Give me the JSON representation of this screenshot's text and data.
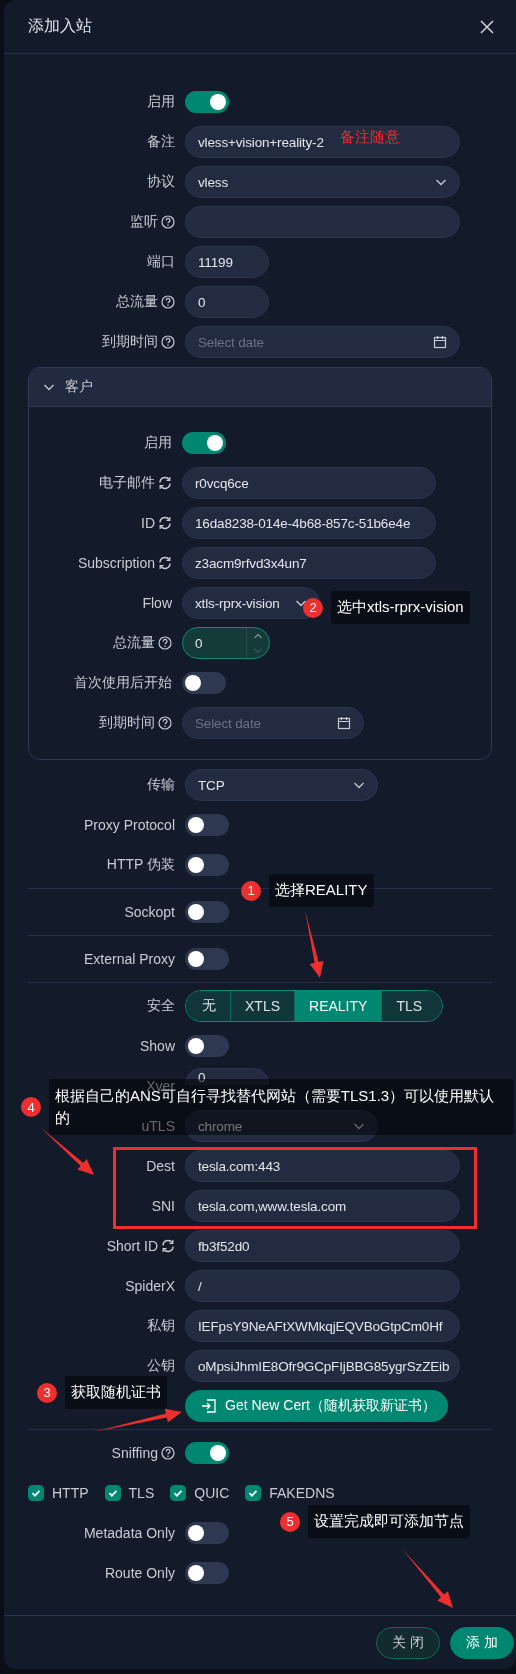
{
  "dialog": {
    "title": "添加入站"
  },
  "fields": [
    {
      "kind": "toggle",
      "label": "启用",
      "on": true
    },
    {
      "kind": "input",
      "label": "备注",
      "value": "vless+vision+reality-2"
    },
    {
      "kind": "select",
      "label": "协议",
      "value": "vless"
    },
    {
      "kind": "input",
      "label": "监听"
    },
    {
      "kind": "number",
      "label": "端口",
      "value": "11199"
    },
    {
      "kind": "number",
      "label": "总流量",
      "value": "0"
    },
    {
      "kind": "date",
      "label": "到期时间",
      "placeholder": "Select date"
    },
    {
      "kind": "panel",
      "title": "客户",
      "expanded": true,
      "fields": [
        {
          "kind": "toggle",
          "label": "启用",
          "on": true
        },
        {
          "kind": "input",
          "label": "电子邮件",
          "value": "r0vcq6ce"
        },
        {
          "kind": "input",
          "label": "ID",
          "value": "16da8238-014e-4b68-857c-51b6e4e"
        },
        {
          "kind": "input",
          "label": "Subscription",
          "value": "z3acm9rfvd3x4un7"
        },
        {
          "kind": "select",
          "label": "Flow",
          "value": "xtls-rprx-vision"
        },
        {
          "kind": "spinner",
          "label": "总流量",
          "value": "0",
          "focused": true
        },
        {
          "kind": "toggle",
          "label": "首次使用后开始",
          "on": false
        },
        {
          "kind": "date",
          "label": "到期时间",
          "placeholder": "Select date"
        }
      ]
    },
    {
      "kind": "select",
      "label": "传输",
      "value": "TCP"
    },
    {
      "kind": "toggle",
      "label": "Proxy Protocol",
      "on": false
    },
    {
      "kind": "toggle",
      "label": "HTTP 伪装",
      "on": false
    },
    {
      "kind": "divider"
    },
    {
      "kind": "toggle",
      "label": "Sockopt",
      "on": false
    },
    {
      "kind": "divider"
    },
    {
      "kind": "toggle",
      "label": "External Proxy",
      "on": false
    },
    {
      "kind": "divider"
    },
    {
      "kind": "segmented",
      "label": "安全",
      "options": [
        {
          "label": "无",
          "selected": false
        },
        {
          "label": "XTLS",
          "selected": false
        },
        {
          "label": "REALITY",
          "selected": true
        },
        {
          "label": "TLS",
          "selected": false
        }
      ]
    },
    {
      "kind": "toggle",
      "label": "Show",
      "on": false
    },
    {
      "kind": "number",
      "label": "Xver",
      "value": "0"
    },
    {
      "kind": "select",
      "label": "uTLS",
      "value": "chrome"
    },
    {
      "kind": "input",
      "label": "Dest",
      "value": "tesla.com:443"
    },
    {
      "kind": "input",
      "label": "SNI",
      "value": "tesla.com,www.tesla.com"
    },
    {
      "kind": "input",
      "label": "Short ID",
      "value": "fb3f52d0"
    },
    {
      "kind": "input",
      "label": "SpiderX",
      "value": "/"
    },
    {
      "kind": "input",
      "label": "私钥",
      "value": "IEFpsY9NeAFtXWMkqjEQVBoGtpCm0Hf"
    },
    {
      "kind": "input",
      "label": "公钥",
      "value": "oMpsiJhmIE8Ofr9GCpFIjBBG85ygrSzZEib"
    },
    {
      "kind": "button",
      "label": "Get New Cert（随机获取新证书）"
    },
    {
      "kind": "divider"
    },
    {
      "kind": "toggle",
      "label": "Sniffing",
      "on": true
    },
    {
      "kind": "checks",
      "items": [
        {
          "label": "HTTP",
          "checked": true
        },
        {
          "label": "TLS",
          "checked": true
        },
        {
          "label": "QUIC",
          "checked": true
        },
        {
          "label": "FAKEDNS",
          "checked": true
        }
      ]
    },
    {
      "kind": "toggle",
      "label": "Metadata Only",
      "on": false
    },
    {
      "kind": "toggle",
      "label": "Route Only",
      "on": false
    }
  ],
  "footer": {
    "buttons": [
      {
        "label": "关 闭",
        "kind": "secondary"
      },
      {
        "label": "添 加",
        "kind": "primary"
      }
    ]
  },
  "annotations": [
    {
      "kind": "note",
      "text": "备注随意"
    },
    {
      "kind": "step",
      "number": "2",
      "text": "选中xtls-rprx-vision"
    },
    {
      "kind": "step",
      "number": "1",
      "text": "选择REALITY"
    },
    {
      "kind": "step",
      "number": "4",
      "text": "根据自己的ANS可自行寻找替代网站（需要TLS1.3）可以使用默认的"
    },
    {
      "kind": "step",
      "number": "3",
      "text": "获取随机证书"
    },
    {
      "kind": "step",
      "number": "5",
      "text": "设置完成即可添加节点"
    }
  ]
}
